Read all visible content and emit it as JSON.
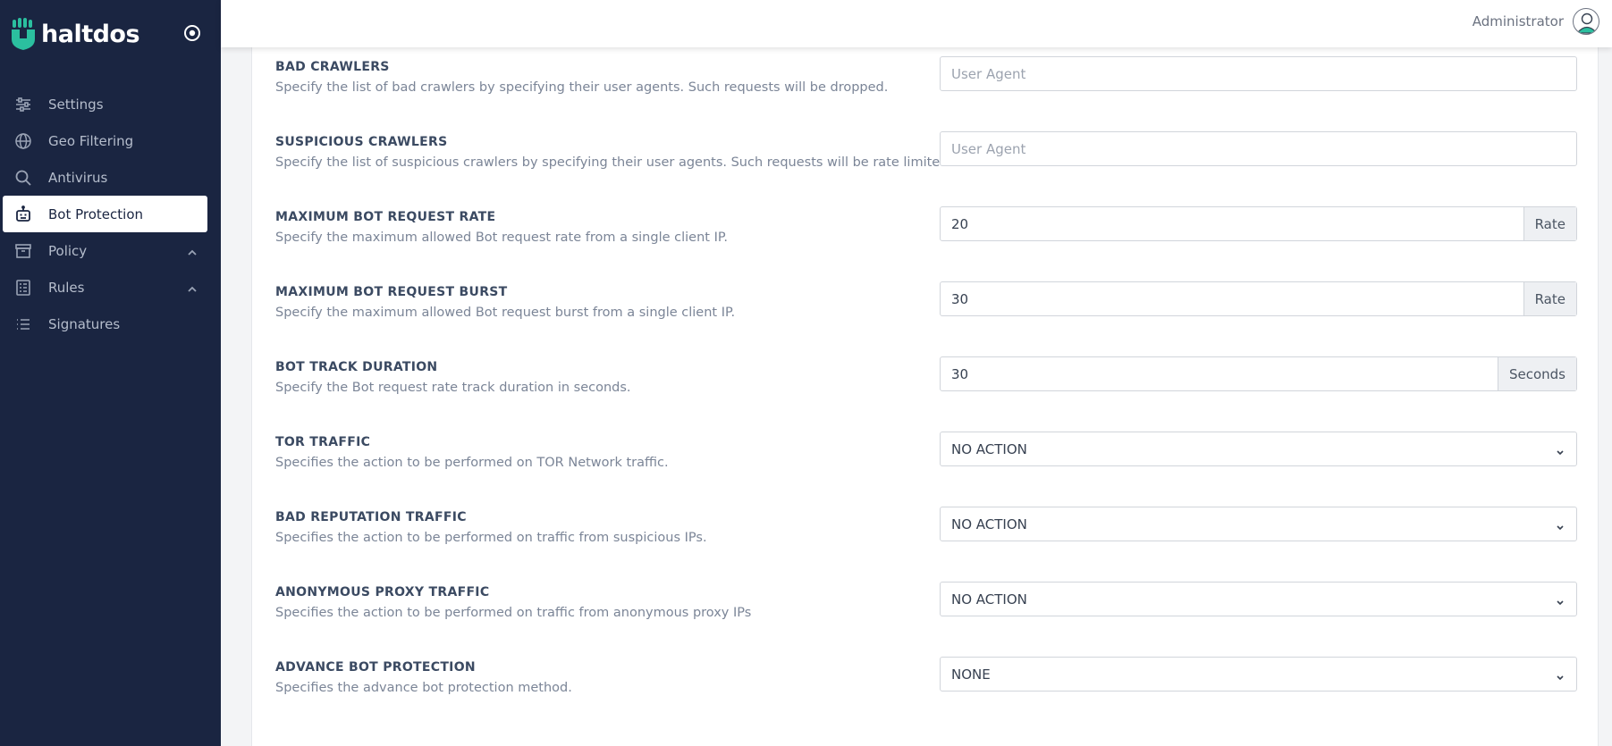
{
  "brand": {
    "name": "haltdos",
    "color": "#2bbf9f"
  },
  "sidebar": {
    "items": [
      {
        "label": "Settings",
        "icon": "sliders-icon",
        "active": false,
        "expandable": false
      },
      {
        "label": "Geo Filtering",
        "icon": "globe-icon",
        "active": false,
        "expandable": false
      },
      {
        "label": "Antivirus",
        "icon": "search-icon",
        "active": false,
        "expandable": false
      },
      {
        "label": "Bot Protection",
        "icon": "robot-icon",
        "active": true,
        "expandable": false
      },
      {
        "label": "Policy",
        "icon": "archive-icon",
        "active": false,
        "expandable": true
      },
      {
        "label": "Rules",
        "icon": "list-box-icon",
        "active": false,
        "expandable": true
      },
      {
        "label": "Signatures",
        "icon": "list-icon",
        "active": false,
        "expandable": false
      }
    ]
  },
  "header": {
    "user_name": "Administrator"
  },
  "settings": [
    {
      "title": "BAD CRAWLERS",
      "description": "Specify the list of bad crawlers by specifying their user agents. Such requests will be dropped.",
      "type": "text",
      "value": "",
      "placeholder": "User Agent"
    },
    {
      "title": "SUSPICIOUS CRAWLERS",
      "description": "Specify the list of suspicious crawlers by specifying their user agents. Such requests will be rate limited.",
      "type": "text",
      "value": "",
      "placeholder": "User Agent"
    },
    {
      "title": "MAXIMUM BOT REQUEST RATE",
      "description": "Specify the maximum allowed Bot request rate from a single client IP.",
      "type": "number",
      "value": "20",
      "unit": "Rate"
    },
    {
      "title": "MAXIMUM BOT REQUEST BURST",
      "description": "Specify the maximum allowed Bot request burst from a single client IP.",
      "type": "number",
      "value": "30",
      "unit": "Rate"
    },
    {
      "title": "BOT TRACK DURATION",
      "description": "Specify the Bot request rate track duration in seconds.",
      "type": "number",
      "value": "30",
      "unit": "Seconds"
    },
    {
      "title": "TOR TRAFFIC",
      "description": "Specifies the action to be performed on TOR Network traffic.",
      "type": "select",
      "value": "NO ACTION"
    },
    {
      "title": "BAD REPUTATION TRAFFIC",
      "description": "Specifies the action to be performed on traffic from suspicious IPs.",
      "type": "select",
      "value": "NO ACTION"
    },
    {
      "title": "ANONYMOUS PROXY TRAFFIC",
      "description": "Specifies the action to be performed on traffic from anonymous proxy IPs",
      "type": "select",
      "value": "NO ACTION"
    },
    {
      "title": "ADVANCE BOT PROTECTION",
      "description": "Specifies the advance bot protection method.",
      "type": "select",
      "value": "NONE"
    }
  ]
}
